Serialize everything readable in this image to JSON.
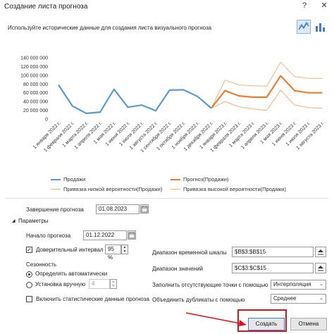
{
  "window": {
    "title": "Создание листа прогноза",
    "help": "?",
    "close": "✕"
  },
  "subtitle": "Используйте исторические данные для создания листа визуального прогноза",
  "chart_data": {
    "type": "line",
    "yticks": [
      "140 000 000",
      "120 000 000",
      "100 000 000",
      "80 000 000",
      "60 000 000",
      "40 000 000",
      "20 000 000",
      "0"
    ],
    "ylim": [
      0,
      140000000
    ],
    "xticks": [
      "1 января 2022 г.",
      "1 февраля 2022 г.",
      "1 марта 2022 г.",
      "1 апреля 2022 г.",
      "1 мая 2022 г.",
      "1 июня 2022 г.",
      "1 июля 2022 г.",
      "1 августа 2022 г.",
      "1 сентября 2022 г.",
      "1 октября 2022 г.",
      "1 ноября 2022 г.",
      "1 декабря 2022 г.",
      "1 января 2023 г.",
      "1 февраля 2023 г.",
      "1 марта 2023 г.",
      "1 апреля 2023 г.",
      "1 мая 2023 г.",
      "1 июня 2023 г.",
      "1 июля 2023 г.",
      "1 августа 2023 г."
    ],
    "series": [
      {
        "name": "Продажи",
        "color": "#5b9bd5",
        "width": 2.2,
        "start": 0,
        "values": [
          78000000,
          30000000,
          13000000,
          16000000,
          68000000,
          27000000,
          32000000,
          19000000,
          66000000,
          67000000,
          52000000,
          25000000
        ]
      },
      {
        "name": "Прогноз(Продажи)",
        "color": "#ed7d31",
        "width": 2.2,
        "start": 11,
        "values": [
          25000000,
          65000000,
          53000000,
          50000000,
          50000000,
          99000000,
          65000000,
          60000000,
          60000000
        ]
      },
      {
        "name": "Привязка низкой вероятности(Продажи)",
        "color": "#f4b183",
        "width": 1,
        "start": 11,
        "values": [
          25000000,
          40000000,
          28000000,
          23000000,
          20000000,
          66000000,
          32000000,
          26000000,
          25000000
        ]
      },
      {
        "name": "Привязка высокой вероятности(Продажи)",
        "color": "#f4b183",
        "width": 1,
        "start": 11,
        "values": [
          25000000,
          89000000,
          78000000,
          76000000,
          75000000,
          130000000,
          97000000,
          93000000,
          93000000
        ]
      }
    ]
  },
  "legend": {
    "sales": "Продажи",
    "forecast": "Прогноз(Продажи)",
    "low": "Привязка низкой вероятности(Продажи)",
    "high": "Привязка высокой вероятности(Продажи)",
    "color_sales": "#5b9bd5",
    "color_forecast": "#ed7d31",
    "color_bound": "#f4b183"
  },
  "forecast_end": {
    "label": "Завершение прогноза",
    "value": "01.08.2023"
  },
  "params": {
    "toggle": "Параметры",
    "start_label": "Начало прогноза",
    "start_value": "01.12.2022",
    "confidence_label": "Доверительный интервал",
    "confidence_checked": true,
    "confidence_value": "95 %",
    "seasonality_label": "Сезонность",
    "auto_label": "Определять автоматически",
    "manual_label": "Установка вручную",
    "manual_value": "4",
    "include_stats_label": "Включить статистические данные прогноза",
    "include_stats_checked": false,
    "timeline_label": "Диапазон временной шкалы",
    "timeline_value": "$B$3:$B$15",
    "values_label": "Диапазон значений",
    "values_value": "$C$3:$C$15",
    "fill_label": "Заполнить отсутствующие точки с помощью",
    "fill_value": "Интерполяция",
    "dup_label": "Объединить дубликаты с помощью",
    "dup_value": "Среднее"
  },
  "buttons": {
    "create": "Создать",
    "cancel": "Отмена"
  }
}
